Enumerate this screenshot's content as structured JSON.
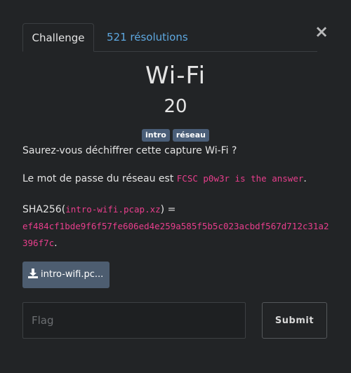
{
  "tabs": {
    "challenge_label": "Challenge",
    "resolutions_label": "521 résolutions"
  },
  "close_glyph": "×",
  "challenge": {
    "title": "Wi-Fi",
    "points": "20",
    "tags": [
      "intro",
      "réseau"
    ],
    "intro": "Saurez-vous déchiffrer cette capture Wi-Fi ?",
    "password_prefix": "Le mot de passe du réseau est ",
    "password": "FCSC p0w3r is the answer",
    "password_suffix": ".",
    "sha_prefix": "SHA256(",
    "sha_filename": "intro-wifi.pcap.xz",
    "sha_mid": ") = ",
    "sha_hash": "ef484cf1bde9f6f57fe606ed4e259a585f5b5c023acbdf567d712c31a2396f7c",
    "sha_suffix": "."
  },
  "download": {
    "icon": "download-icon",
    "label": "intro-wifi.pc..."
  },
  "flag": {
    "placeholder": "Flag",
    "value": ""
  },
  "submit_label": "Submit",
  "colors": {
    "background": "#222426",
    "tag_bg": "#4a5e78",
    "link": "#5ea8e0",
    "code": "#e83e8c",
    "download_bg": "#4d5d70"
  }
}
